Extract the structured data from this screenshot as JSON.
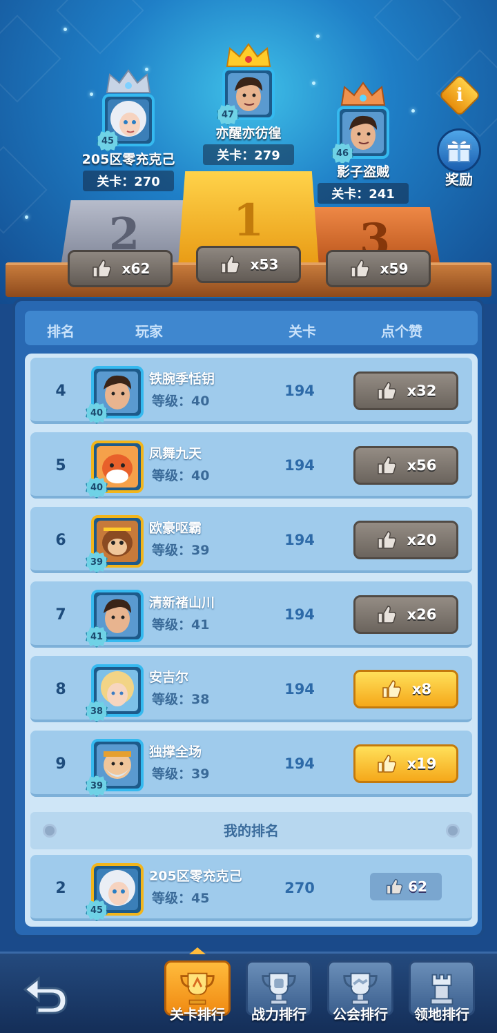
{
  "podium": {
    "first": {
      "name": "亦醒亦彷徨",
      "stage": "关卡：279",
      "level": "47",
      "likes": "x53",
      "place": "1"
    },
    "second": {
      "name": "205区零充克己",
      "stage": "关卡：270",
      "level": "45",
      "likes": "x62",
      "place": "2"
    },
    "third": {
      "name": "影子盗贼",
      "stage": "关卡：241",
      "level": "46",
      "likes": "x59",
      "place": "3"
    }
  },
  "side": {
    "info_icon": "i",
    "reward_label": "奖励"
  },
  "table": {
    "headers": {
      "rank": "排名",
      "player": "玩家",
      "stage": "关卡",
      "like": "点个赞"
    },
    "rows": [
      {
        "rank": "4",
        "name": "铁腕季恬钥",
        "level": "等级：40",
        "badge": "40",
        "stage": "194",
        "likes": "x32",
        "liked": false
      },
      {
        "rank": "5",
        "name": "凤舞九天",
        "level": "等级：40",
        "badge": "40",
        "stage": "194",
        "likes": "x56",
        "liked": false
      },
      {
        "rank": "6",
        "name": "欧豪呕霸",
        "level": "等级：39",
        "badge": "39",
        "stage": "194",
        "likes": "x20",
        "liked": false
      },
      {
        "rank": "7",
        "name": "清新褚山川",
        "level": "等级：41",
        "badge": "41",
        "stage": "194",
        "likes": "x26",
        "liked": false
      },
      {
        "rank": "8",
        "name": "安吉尔",
        "level": "等级：38",
        "badge": "38",
        "stage": "194",
        "likes": "x8",
        "liked": true
      },
      {
        "rank": "9",
        "name": "独撑全场",
        "level": "等级：39",
        "badge": "39",
        "stage": "194",
        "likes": "x19",
        "liked": true
      }
    ]
  },
  "my_rank": {
    "title": "我的排名",
    "rank": "2",
    "name": "205区零充克己",
    "level": "等级：45",
    "badge": "45",
    "stage": "270",
    "likes": "62"
  },
  "tabs": [
    {
      "label": "关卡排行",
      "icon": "trophy-icon",
      "active": true
    },
    {
      "label": "战力排行",
      "icon": "fist-trophy-icon",
      "active": false
    },
    {
      "label": "公会排行",
      "icon": "handshake-trophy-icon",
      "active": false
    },
    {
      "label": "领地排行",
      "icon": "castle-tower-icon",
      "active": false
    }
  ],
  "colors": {
    "accent": "#f5a81a",
    "panel": "#2868b2",
    "liked": "#ffe05a"
  }
}
